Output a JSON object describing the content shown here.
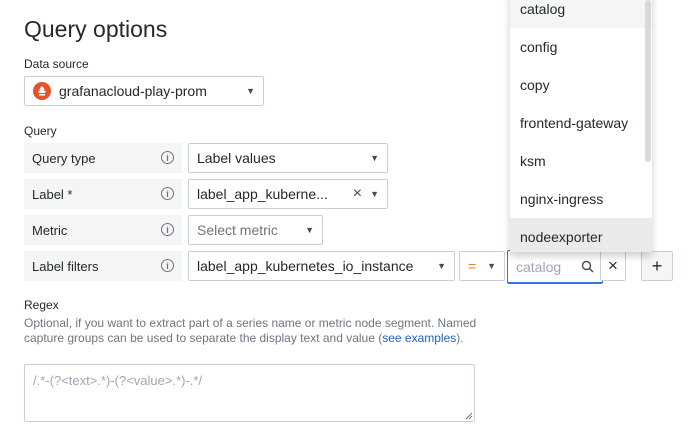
{
  "page": {
    "title": "Query options"
  },
  "datasource": {
    "label": "Data source",
    "value": "grafanacloud-play-prom"
  },
  "query": {
    "section_label": "Query",
    "rows": {
      "query_type": {
        "label": "Query type",
        "value": "Label values"
      },
      "label": {
        "label": "Label *",
        "value": "label_app_kuberne..."
      },
      "metric": {
        "label": "Metric",
        "placeholder": "Select metric"
      },
      "label_filters": {
        "label": "Label filters",
        "key": "label_app_kubernetes_io_instance",
        "operator": "=",
        "value_placeholder": "catalog"
      }
    }
  },
  "regex": {
    "label": "Regex",
    "help_text": "Optional, if you want to extract part of a series name or metric node segment. Named capture groups can be used to separate the display text and value (",
    "help_link": "see examples",
    "help_suffix": ").",
    "placeholder": "/.*-(?<text>.*)-(?<value>.*)-.*/"
  },
  "dropdown": {
    "items": [
      "catalog",
      "config",
      "copy",
      "frontend-gateway",
      "ksm",
      "nginx-ingress",
      "nodeexporter"
    ]
  },
  "icons": {
    "info": "i",
    "clear": "×",
    "add": "+",
    "search": "search-icon",
    "chevron": "⌄"
  },
  "colors": {
    "accent": "#3274d9",
    "operator": "#eb7b18",
    "label_bg": "#f4f5f5",
    "border": "#c7d0d9"
  }
}
